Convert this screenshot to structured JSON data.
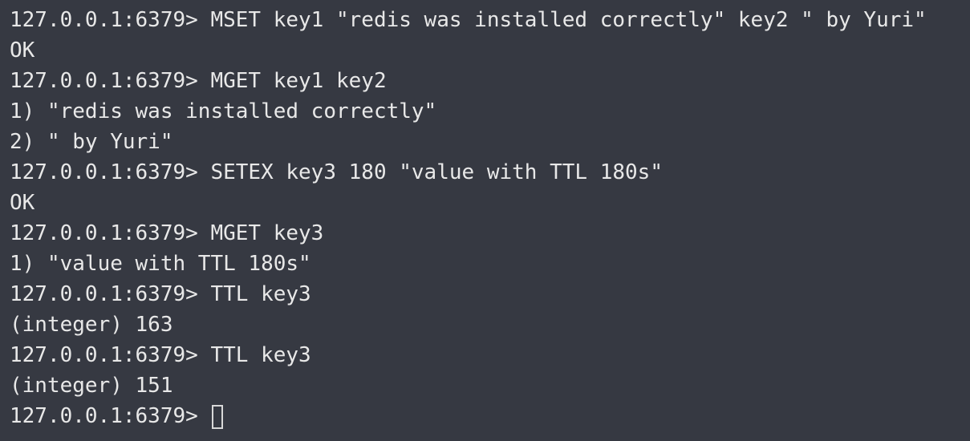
{
  "terminal": {
    "prompt": "127.0.0.1:6379>",
    "lines": [
      "127.0.0.1:6379> MSET key1 \"redis was installed correctly\" key2 \" by Yuri\"",
      "OK",
      "127.0.0.1:6379> MGET key1 key2",
      "1) \"redis was installed correctly\"",
      "2) \" by Yuri\"",
      "127.0.0.1:6379> SETEX key3 180 \"value with TTL 180s\"",
      "OK",
      "127.0.0.1:6379> MGET key3",
      "1) \"value with TTL 180s\"",
      "127.0.0.1:6379> TTL key3",
      "(integer) 163",
      "127.0.0.1:6379> TTL key3",
      "(integer) 151"
    ]
  }
}
